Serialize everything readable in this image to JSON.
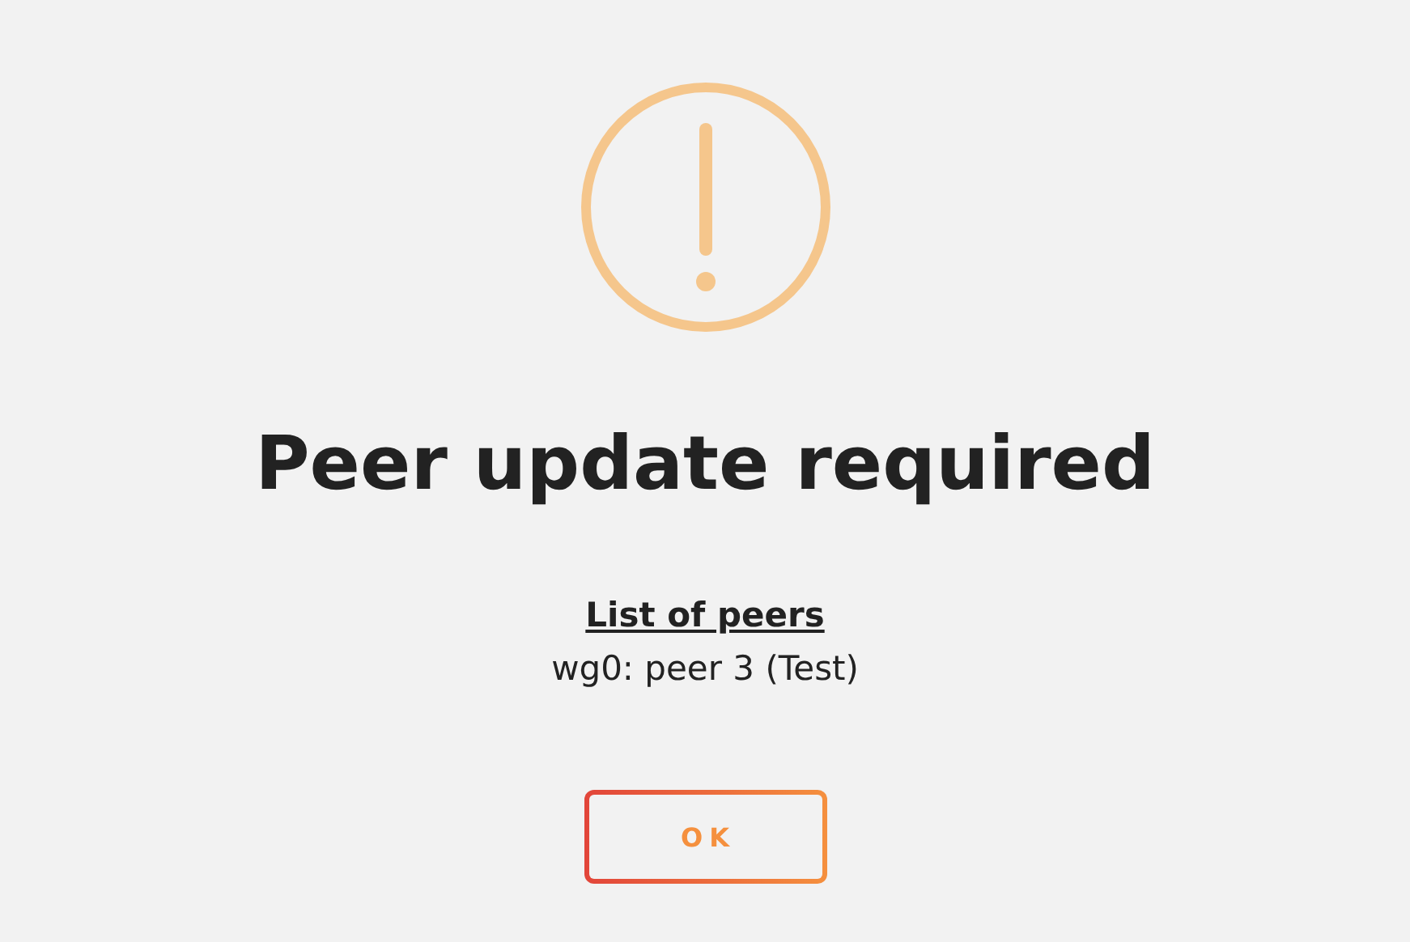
{
  "dialog": {
    "title": "Peer update required",
    "link": "List of peers",
    "peers": [
      "wg0: peer 3 (Test)"
    ],
    "buttons": [
      "OK"
    ]
  }
}
